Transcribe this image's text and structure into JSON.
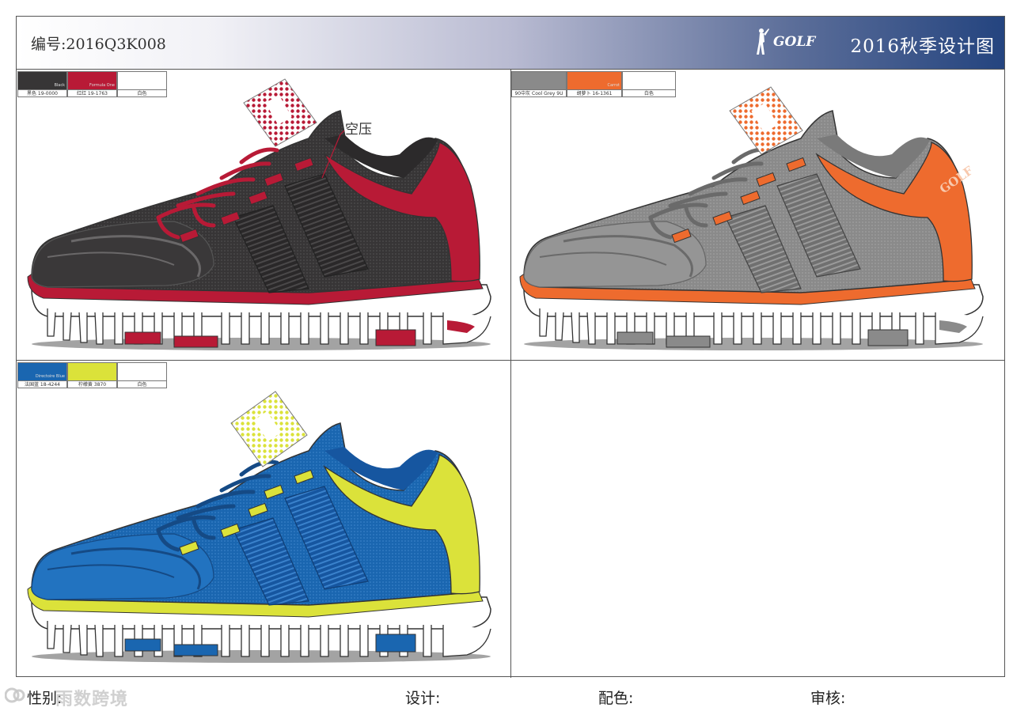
{
  "header": {
    "code": "编号:2016Q3K008",
    "brand": "GOLF",
    "title": "2016秋季设计图"
  },
  "colors": {
    "black": "#373536",
    "red": "#b81a36",
    "white": "#ffffff",
    "grey": "#8a8a8a",
    "orange": "#ee6b2e",
    "blue": "#1a66b0",
    "yellow": "#dbe23a"
  },
  "variants": [
    {
      "id": "black-red",
      "swatches": [
        {
          "label": "黑色 19-0000",
          "code": "",
          "name": "Black"
        },
        {
          "label": "红红 19-1763",
          "code": "",
          "name": "Formula One"
        },
        {
          "label": "白色",
          "code": "",
          "name": ""
        }
      ],
      "annotation": "空压"
    },
    {
      "id": "grey-orange",
      "swatches": [
        {
          "label": "90中灰",
          "sub": "Cool Grey 9U",
          "code": "",
          "name": ""
        },
        {
          "label": "胡萝卜 16-1361",
          "code": "",
          "name": "Carrot"
        },
        {
          "label": "白色",
          "code": "",
          "name": ""
        }
      ],
      "side_text": "GOLF"
    },
    {
      "id": "blue-yellow",
      "swatches": [
        {
          "label": "法国蓝 18-4244",
          "code": "",
          "name": "Directoire Blue"
        },
        {
          "label": "柠檬黄 3870",
          "code": "",
          "name": ""
        },
        {
          "label": "白色",
          "code": "",
          "name": ""
        }
      ]
    }
  ],
  "footer": {
    "gender": "性别:",
    "design": "设计:",
    "colorway": "配色:",
    "review": "审核:",
    "watermark": "雨数跨境"
  }
}
